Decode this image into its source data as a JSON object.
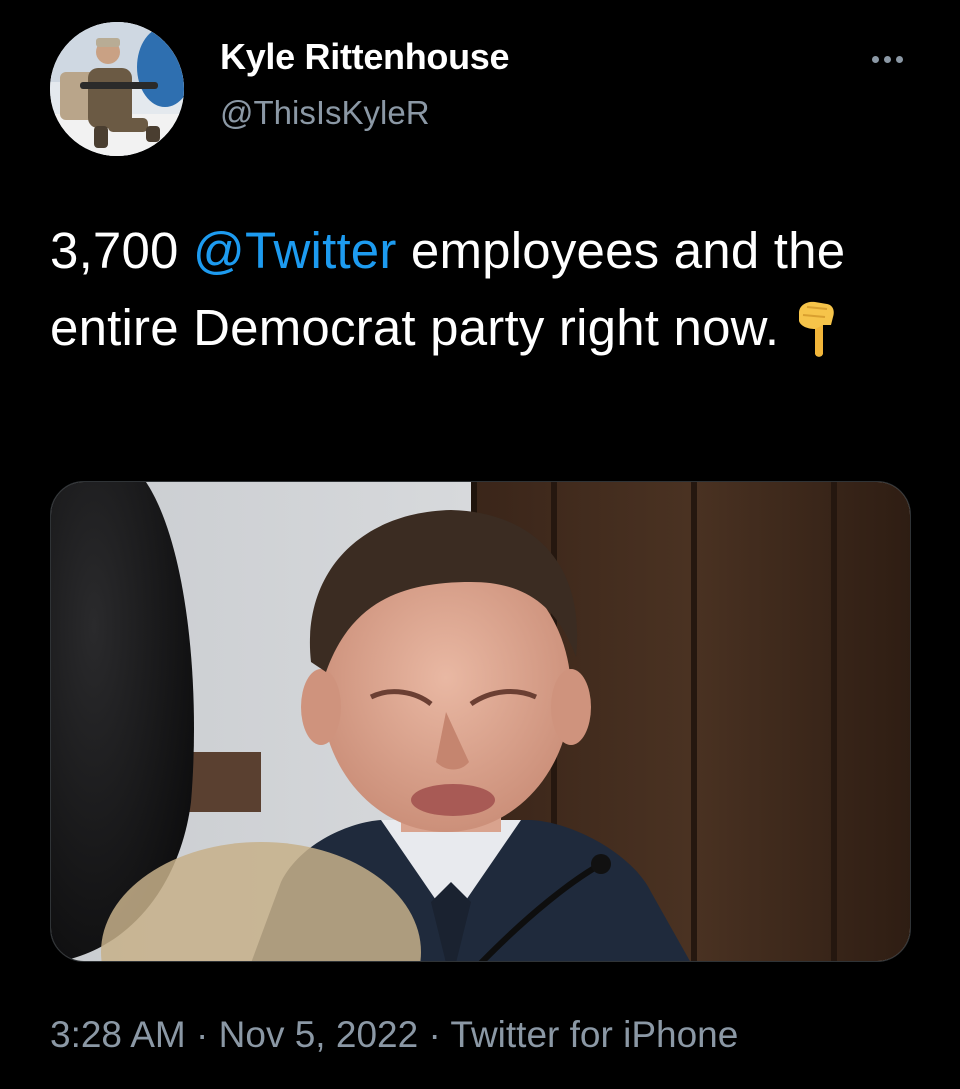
{
  "author": {
    "display_name": "Kyle Rittenhouse",
    "handle": "@ThisIsKyleR"
  },
  "tweet": {
    "text_prefix": "3,700 ",
    "mention": "@Twitter",
    "text_suffix": " employees and the entire Democrat party right now.",
    "emoji": "backhand-index-pointing-down-icon"
  },
  "meta": {
    "time": "3:28 AM",
    "separator_1": " · ",
    "date": "Nov 5, 2022",
    "separator_2": " · ",
    "source": "Twitter for iPhone"
  },
  "colors": {
    "background": "#000000",
    "text": "#ffffff",
    "secondary": "#8b98a5",
    "link": "#1d9bf0"
  }
}
